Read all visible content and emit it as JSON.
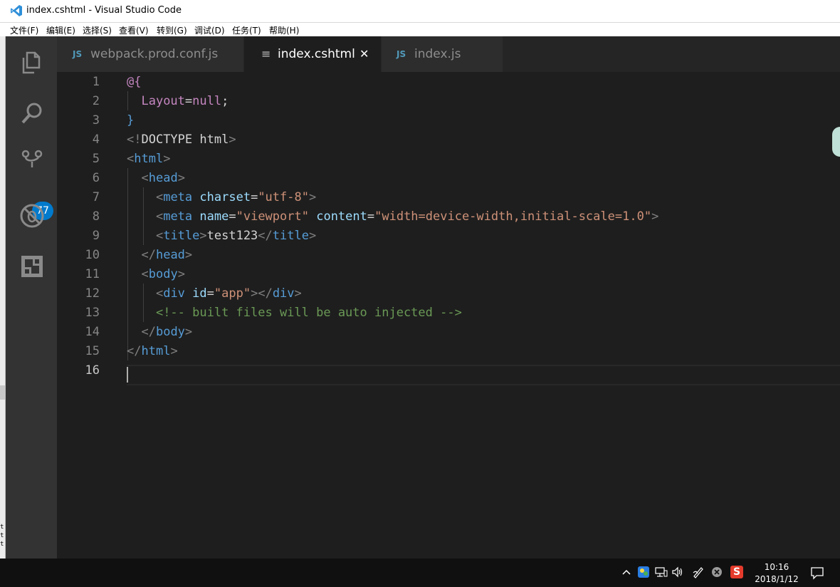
{
  "window": {
    "title": "index.cshtml - Visual Studio Code"
  },
  "menu": [
    "文件(F)",
    "编辑(E)",
    "选择(S)",
    "查看(V)",
    "转到(G)",
    "调试(D)",
    "任务(T)",
    "帮助(H)"
  ],
  "activity_bar": {
    "items": [
      "files-icon",
      "search-icon",
      "source-control-icon",
      "debug-icon",
      "extensions-icon"
    ],
    "scm_badge": "77"
  },
  "tabs": [
    {
      "icon": "JS",
      "label": "webpack.prod.conf.js",
      "active": false
    },
    {
      "icon": "≡",
      "label": "index.cshtml",
      "active": true,
      "close": "✕"
    },
    {
      "icon": "JS",
      "label": "index.js",
      "active": false
    }
  ],
  "colors": {
    "tag": "#569cd6",
    "attr": "#9cdcfe",
    "string": "#ce9178",
    "comment": "#6a9955",
    "razor": "#c586c0",
    "bracket": "#808080",
    "text": "#d4d4d4",
    "line_number": "#858585",
    "badge": "#007acc"
  },
  "editor": {
    "cursor_line": 16,
    "lines": [
      {
        "n": "1",
        "tokens": [
          {
            "t": "@{",
            "c": "razor"
          }
        ]
      },
      {
        "n": "2",
        "tokens": [
          {
            "t": "  ",
            "c": "text"
          },
          {
            "t": "Layout",
            "c": "razor"
          },
          {
            "t": "=",
            "c": "text"
          },
          {
            "t": "null",
            "c": "razor"
          },
          {
            "t": ";",
            "c": "text"
          }
        ]
      },
      {
        "n": "3",
        "tokens": [
          {
            "t": "}",
            "c": "tag"
          }
        ]
      },
      {
        "n": "4",
        "tokens": [
          {
            "t": "<!",
            "c": "bracket"
          },
          {
            "t": "DOCTYPE html",
            "c": "text"
          },
          {
            "t": ">",
            "c": "bracket"
          }
        ]
      },
      {
        "n": "5",
        "tokens": [
          {
            "t": "<",
            "c": "bracket"
          },
          {
            "t": "html",
            "c": "tag"
          },
          {
            "t": ">",
            "c": "bracket"
          }
        ]
      },
      {
        "n": "6",
        "tokens": [
          {
            "t": "  ",
            "c": "text"
          },
          {
            "t": "<",
            "c": "bracket"
          },
          {
            "t": "head",
            "c": "tag"
          },
          {
            "t": ">",
            "c": "bracket"
          }
        ]
      },
      {
        "n": "7",
        "tokens": [
          {
            "t": "    ",
            "c": "text"
          },
          {
            "t": "<",
            "c": "bracket"
          },
          {
            "t": "meta",
            "c": "tag"
          },
          {
            "t": " ",
            "c": "text"
          },
          {
            "t": "charset",
            "c": "attr"
          },
          {
            "t": "=",
            "c": "text"
          },
          {
            "t": "\"utf-8\"",
            "c": "string"
          },
          {
            "t": ">",
            "c": "bracket"
          }
        ]
      },
      {
        "n": "8",
        "tokens": [
          {
            "t": "    ",
            "c": "text"
          },
          {
            "t": "<",
            "c": "bracket"
          },
          {
            "t": "meta",
            "c": "tag"
          },
          {
            "t": " ",
            "c": "text"
          },
          {
            "t": "name",
            "c": "attr"
          },
          {
            "t": "=",
            "c": "text"
          },
          {
            "t": "\"viewport\"",
            "c": "string"
          },
          {
            "t": " ",
            "c": "text"
          },
          {
            "t": "content",
            "c": "attr"
          },
          {
            "t": "=",
            "c": "text"
          },
          {
            "t": "\"width=device-width,initial-scale=1.0\"",
            "c": "string"
          },
          {
            "t": ">",
            "c": "bracket"
          }
        ]
      },
      {
        "n": "9",
        "tokens": [
          {
            "t": "    ",
            "c": "text"
          },
          {
            "t": "<",
            "c": "bracket"
          },
          {
            "t": "title",
            "c": "tag"
          },
          {
            "t": ">",
            "c": "bracket"
          },
          {
            "t": "test123",
            "c": "text"
          },
          {
            "t": "</",
            "c": "bracket"
          },
          {
            "t": "title",
            "c": "tag"
          },
          {
            "t": ">",
            "c": "bracket"
          }
        ]
      },
      {
        "n": "10",
        "tokens": [
          {
            "t": "  ",
            "c": "text"
          },
          {
            "t": "</",
            "c": "bracket"
          },
          {
            "t": "head",
            "c": "tag"
          },
          {
            "t": ">",
            "c": "bracket"
          }
        ]
      },
      {
        "n": "11",
        "tokens": [
          {
            "t": "  ",
            "c": "text"
          },
          {
            "t": "<",
            "c": "bracket"
          },
          {
            "t": "body",
            "c": "tag"
          },
          {
            "t": ">",
            "c": "bracket"
          }
        ]
      },
      {
        "n": "12",
        "tokens": [
          {
            "t": "    ",
            "c": "text"
          },
          {
            "t": "<",
            "c": "bracket"
          },
          {
            "t": "div",
            "c": "tag"
          },
          {
            "t": " ",
            "c": "text"
          },
          {
            "t": "id",
            "c": "attr"
          },
          {
            "t": "=",
            "c": "text"
          },
          {
            "t": "\"app\"",
            "c": "string"
          },
          {
            "t": "></",
            "c": "bracket"
          },
          {
            "t": "div",
            "c": "tag"
          },
          {
            "t": ">",
            "c": "bracket"
          }
        ]
      },
      {
        "n": "13",
        "tokens": [
          {
            "t": "    ",
            "c": "text"
          },
          {
            "t": "<!-- built files will be auto injected -->",
            "c": "comment"
          }
        ]
      },
      {
        "n": "14",
        "tokens": [
          {
            "t": "  ",
            "c": "text"
          },
          {
            "t": "</",
            "c": "bracket"
          },
          {
            "t": "body",
            "c": "tag"
          },
          {
            "t": ">",
            "c": "bracket"
          }
        ]
      },
      {
        "n": "15",
        "tokens": [
          {
            "t": "</",
            "c": "bracket"
          },
          {
            "t": "html",
            "c": "tag"
          },
          {
            "t": ">",
            "c": "bracket"
          }
        ]
      },
      {
        "n": "16",
        "tokens": []
      }
    ]
  },
  "taskbar": {
    "tray_icons": [
      "chevron-up-icon",
      "network-people-icon",
      "network-icon",
      "volume-icon",
      "pen-icon",
      "close-circle-icon",
      "sogou-ime-icon"
    ],
    "ime_label": "S",
    "time": "10:16",
    "date": "2018/1/12",
    "notification_icon": "notification-icon"
  }
}
